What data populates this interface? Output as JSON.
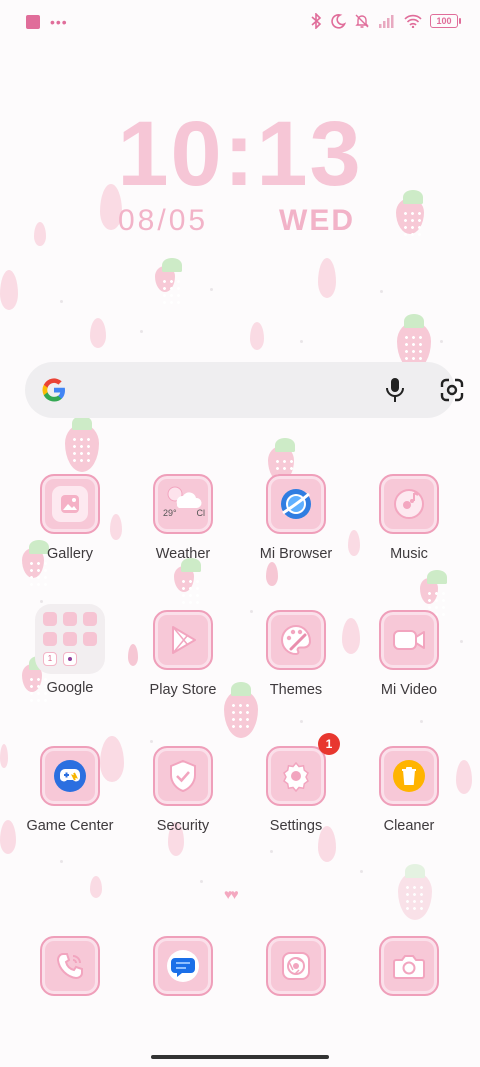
{
  "status_bar": {
    "left_icons": [
      "notification-square-icon",
      "more-dots-icon"
    ],
    "right_icons": [
      "bluetooth-icon",
      "do-not-disturb-moon-icon",
      "bell-off-icon",
      "signal-icon",
      "wifi-icon"
    ],
    "battery": "100"
  },
  "clock": {
    "time": "10:13",
    "date": "08/05",
    "weekday": "WED"
  },
  "search": {
    "icons": [
      "google-g-icon",
      "microphone-icon",
      "google-lens-icon"
    ]
  },
  "apps": [
    {
      "label": "Gallery",
      "icon": "gallery-icon"
    },
    {
      "label": "Weather",
      "icon": "weather-icon",
      "temp": "29°",
      "cond": "Cl"
    },
    {
      "label": "Mi Browser",
      "icon": "browser-icon"
    },
    {
      "label": "Music",
      "icon": "music-icon"
    },
    {
      "label": "Google",
      "icon": "folder-icon",
      "folder_items": [
        "1"
      ]
    },
    {
      "label": "Play Store",
      "icon": "play-store-icon"
    },
    {
      "label": "Themes",
      "icon": "palette-icon"
    },
    {
      "label": "Mi Video",
      "icon": "video-icon"
    },
    {
      "label": "Game Center",
      "icon": "gamepad-icon"
    },
    {
      "label": "Security",
      "icon": "shield-check-icon"
    },
    {
      "label": "Settings",
      "icon": "gear-icon",
      "badge": "1"
    },
    {
      "label": "Cleaner",
      "icon": "trash-icon"
    }
  ],
  "dock": [
    {
      "name": "phone",
      "icon": "phone-icon"
    },
    {
      "name": "messages",
      "icon": "message-bubble-icon"
    },
    {
      "name": "chrome",
      "icon": "chrome-icon"
    },
    {
      "name": "camera",
      "icon": "camera-icon"
    }
  ],
  "colors": {
    "accent": "#e06d9a",
    "icon_bg": "#f7c8d7",
    "icon_border": "#ef9fba",
    "badge": "#e8372f"
  }
}
